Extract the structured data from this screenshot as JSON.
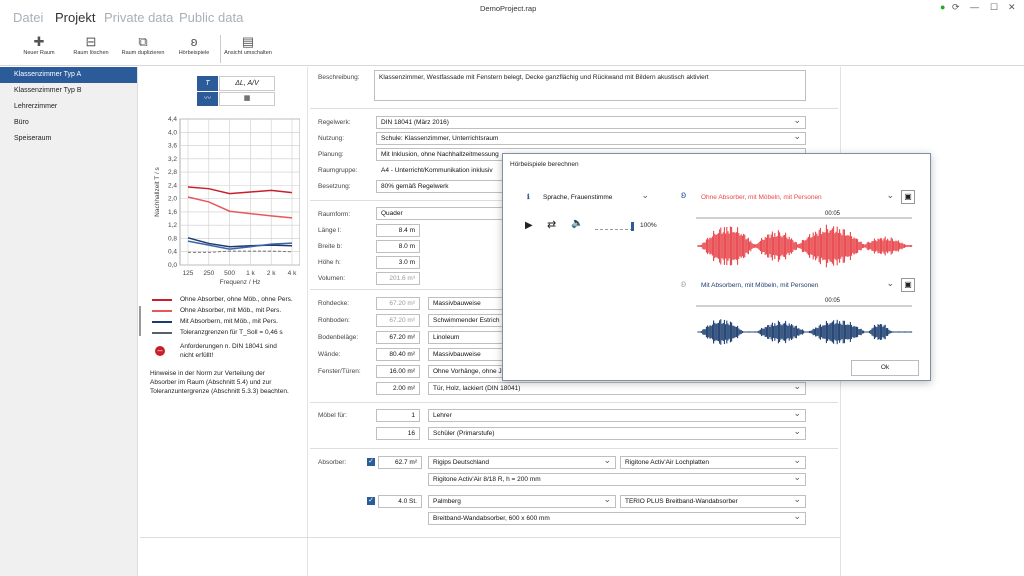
{
  "window": {
    "title": "DemoProject.rap"
  },
  "menu": [
    "Datei",
    "Projekt",
    "Private data",
    "Public data"
  ],
  "toolbar": [
    "Neuer Raum",
    "Raum löschen",
    "Raum duplizieren",
    "Hörbeispiele",
    "Ansicht umschalten"
  ],
  "sidebar": [
    "Klassenzimmer Typ A",
    "Klassenzimmer Typ B",
    "Lehrerzimmer",
    "Büro",
    "Speiseraum"
  ],
  "chart_toggle": {
    "t_label": "T",
    "dl_label": "ΔL, A/V"
  },
  "chart_data": {
    "type": "line",
    "x": [
      "125",
      "250",
      "500",
      "1 k",
      "2 k",
      "4 k"
    ],
    "ylabel": "Nachhallzeit T / s",
    "xlabel": "Frequenz / Hz",
    "yticks": [
      "4,4",
      "4,0",
      "3,6",
      "3,2",
      "2,8",
      "2,4",
      "2,0",
      "1,6",
      "1,2",
      "0,8",
      "0,4",
      "0,0"
    ],
    "ylim": [
      0,
      4.4
    ],
    "series": [
      {
        "name": "Ohne Absorber, ohne Möb., ohne Pers.",
        "color": "#c8202a",
        "values": [
          2.35,
          2.3,
          2.15,
          2.2,
          2.25,
          2.18
        ]
      },
      {
        "name": "Ohne Absorber, mit Möb., mit Pers.",
        "color": "#e8585a",
        "values": [
          2.05,
          1.9,
          1.62,
          1.55,
          1.48,
          1.42
        ]
      },
      {
        "name": "Mit Absorbern, mit Möb., mit Pers.",
        "color": "#1f3a6e",
        "values": [
          0.82,
          0.65,
          0.55,
          0.58,
          0.6,
          0.58
        ]
      },
      {
        "name": "Mit Absorbern, mit Möb., ohne Pers.",
        "color": "#3e64a8",
        "values": [
          0.72,
          0.6,
          0.48,
          0.55,
          0.63,
          0.66
        ]
      },
      {
        "name": "Toleranzgrenzen für T_Soll = 0,46 s",
        "color": "#777777",
        "dashed": true,
        "values": [
          0.38,
          0.38,
          0.42,
          0.42,
          0.42,
          0.4
        ]
      }
    ]
  },
  "legend": [
    {
      "label": "Ohne Absorber, ohne Möb., ohne Pers.",
      "color": "#c8202a"
    },
    {
      "label": "Ohne Absorber, mit Möb., mit Pers.",
      "color": "#e8585a"
    },
    {
      "label": "Mit Absorbern, mit Möb., mit Pers.",
      "color": "#1f3a6e"
    },
    {
      "label": "Toleranzgrenzen für T_Soll = 0,46 s",
      "color": "#556070"
    }
  ],
  "warning": "Anforderungen n. DIN 18041 sind nicht erfüllt!",
  "note": "Hinweise in der Norm zur Verteilung der Absorber im Raum (Abschnitt 5.4) und zur Toleranzuntergrenze (Abschnitt 5.3.3) beachten.",
  "form": {
    "beschreibung_label": "Beschreibung:",
    "beschreibung": "Klassenzimmer, Westfassade mit Fenstern belegt, Decke ganzflächig und Rückwand mit Bildern akustisch aktiviert",
    "regelwerk_label": "Regelwerk:",
    "regelwerk": "DIN 18041 (März 2016)",
    "nutzung_label": "Nutzung:",
    "nutzung": "Schule: Klassenzimmer, Unterrichtsraum",
    "planung_label": "Planung:",
    "planung": "Mit Inklusion, ohne Nachhallzeitmessung",
    "raumgruppe_label": "Raumgruppe:",
    "raumgruppe": "A4 - Unterricht/Kommunikation inklusiv",
    "besetzung_label": "Besetzung:",
    "besetzung": "80% gemäß Regelwerk",
    "raumform_label": "Raumform:",
    "raumform": "Quader",
    "laenge_label": "Länge l:",
    "laenge": "8.4 m",
    "breite_label": "Breite b:",
    "breite": "8.0 m",
    "hoehe_label": "Höhe h:",
    "hoehe": "3.0 m",
    "volumen_label": "Volumen:",
    "volumen": "201.6 m³",
    "surfaces": [
      {
        "label": "Rohdecke:",
        "area": "67.20 m²",
        "material": "Massivbauweise",
        "dim": true
      },
      {
        "label": "Rohboden:",
        "area": "67.20 m²",
        "material": "Schwimmender Estrich",
        "dim": true
      },
      {
        "label": "Bodenbeläge:",
        "area": "67.20 m²",
        "material": "Linoleum",
        "dim": false
      },
      {
        "label": "Wände:",
        "area": "80.40 m²",
        "material": "Massivbauweise",
        "dim": false
      },
      {
        "label": "Fenster/Türen:",
        "area": "16.00 m²",
        "material": "Ohne Vorhänge, ohne Ja",
        "dim": false
      },
      {
        "label": "",
        "area": "2.00 m²",
        "material": "Tür, Holz, lackiert (DIN 18041)",
        "dim": false
      }
    ],
    "moebel_label": "Möbel für:",
    "moebel": [
      {
        "count": "1",
        "name": "Lehrer"
      },
      {
        "count": "16",
        "name": "Schüler (Primarstufe)"
      }
    ],
    "absorber_label": "Absorber:",
    "absorber": [
      {
        "qty": "62.7 m²",
        "maker": "Rigips Deutschland",
        "product": "Rigitone Activ'Air Lochplatten",
        "variant": "Rigitone Activ'Air 8/18 R, h = 200 mm"
      },
      {
        "qty": "4.0 St.",
        "maker": "Palmberg",
        "product": "TERIO PLUS Breitband-Wandabsorber",
        "variant": "Breitband-Wandabsorber, 600 x 600 mm"
      }
    ]
  },
  "dialog": {
    "title": "Hörbeispiele berechnen",
    "source": "Sprache, Frauenstimme",
    "volume": "100%",
    "volume_level": 1.0,
    "top_label": "Ohne Absorber, mit Möbeln, mit Personen",
    "bottom_label": "Mit Absorbern, mit Möbeln, mit Personen",
    "time_mark": "00:05",
    "ok": "Ok",
    "colors": {
      "top": "#e8474c",
      "bottom": "#1c3f70"
    }
  }
}
